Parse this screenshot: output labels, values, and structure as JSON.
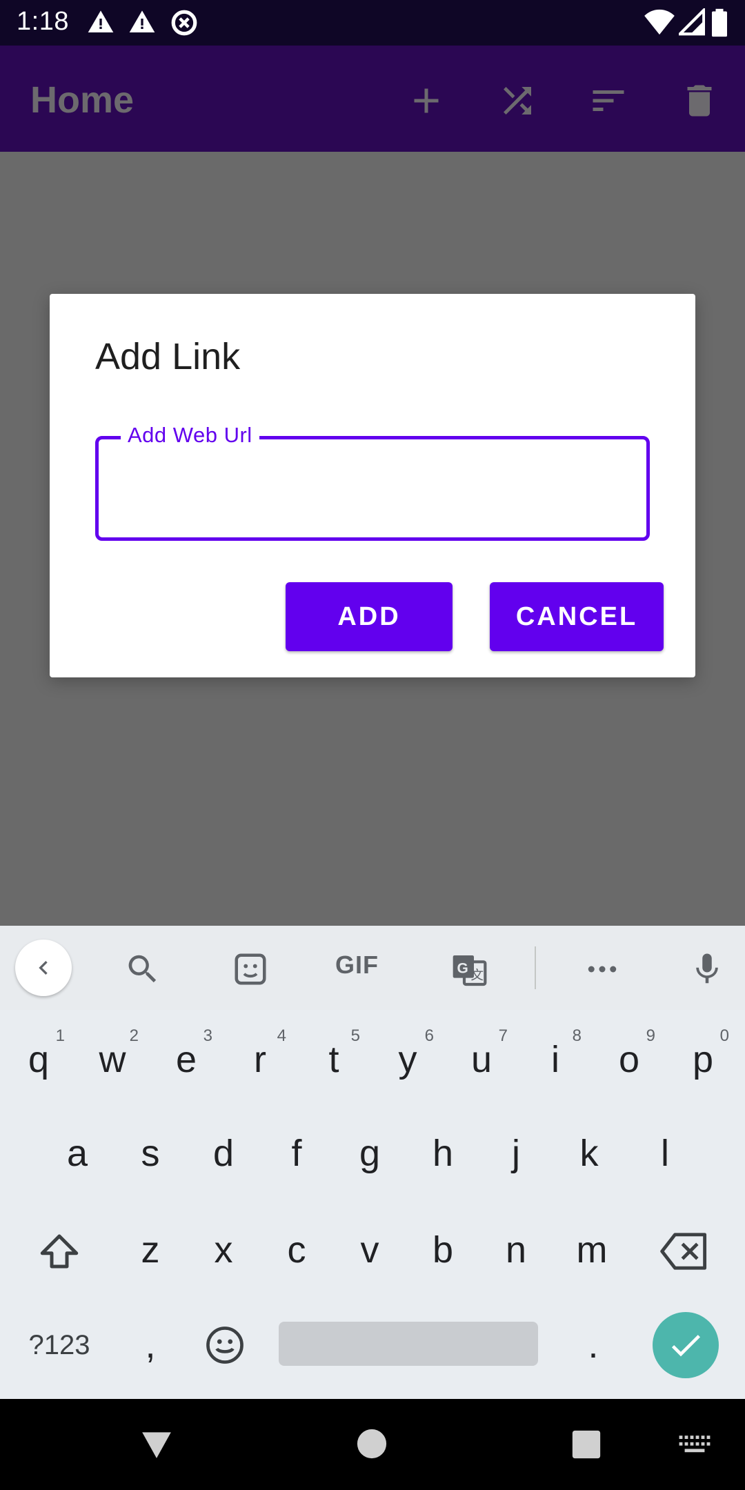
{
  "status_bar": {
    "time": "1:18",
    "icons": [
      "warning-icon",
      "warning-icon",
      "data-saver-icon",
      "wifi-icon",
      "cell-signal-icon",
      "battery-icon"
    ]
  },
  "app_bar": {
    "title": "Home",
    "actions": [
      "add-icon",
      "shuffle-icon",
      "sort-icon",
      "delete-icon"
    ]
  },
  "dialog": {
    "title": "Add Link",
    "field_label": "Add Web Url",
    "field_value": "",
    "add_label": "ADD",
    "cancel_label": "CANCEL"
  },
  "keyboard": {
    "toolbar": {
      "gif_label": "GIF",
      "icons": [
        "back-chevron-icon",
        "search-icon",
        "sticker-icon",
        "gif-icon",
        "translate-icon",
        "more-icon",
        "mic-icon"
      ]
    },
    "row1": [
      {
        "k": "q",
        "s": "1"
      },
      {
        "k": "w",
        "s": "2"
      },
      {
        "k": "e",
        "s": "3"
      },
      {
        "k": "r",
        "s": "4"
      },
      {
        "k": "t",
        "s": "5"
      },
      {
        "k": "y",
        "s": "6"
      },
      {
        "k": "u",
        "s": "7"
      },
      {
        "k": "i",
        "s": "8"
      },
      {
        "k": "o",
        "s": "9"
      },
      {
        "k": "p",
        "s": "0"
      }
    ],
    "row2": [
      "a",
      "s",
      "d",
      "f",
      "g",
      "h",
      "j",
      "k",
      "l"
    ],
    "row3": [
      "z",
      "x",
      "c",
      "v",
      "b",
      "n",
      "m"
    ],
    "symbols_label": "?123",
    "comma": ",",
    "period": "."
  },
  "colors": {
    "accent": "#6200ee",
    "app_bar": "#2b0753",
    "status_bar": "#0f0626",
    "enter_key": "#4db6ac",
    "scrim": "#6a6a6a"
  }
}
